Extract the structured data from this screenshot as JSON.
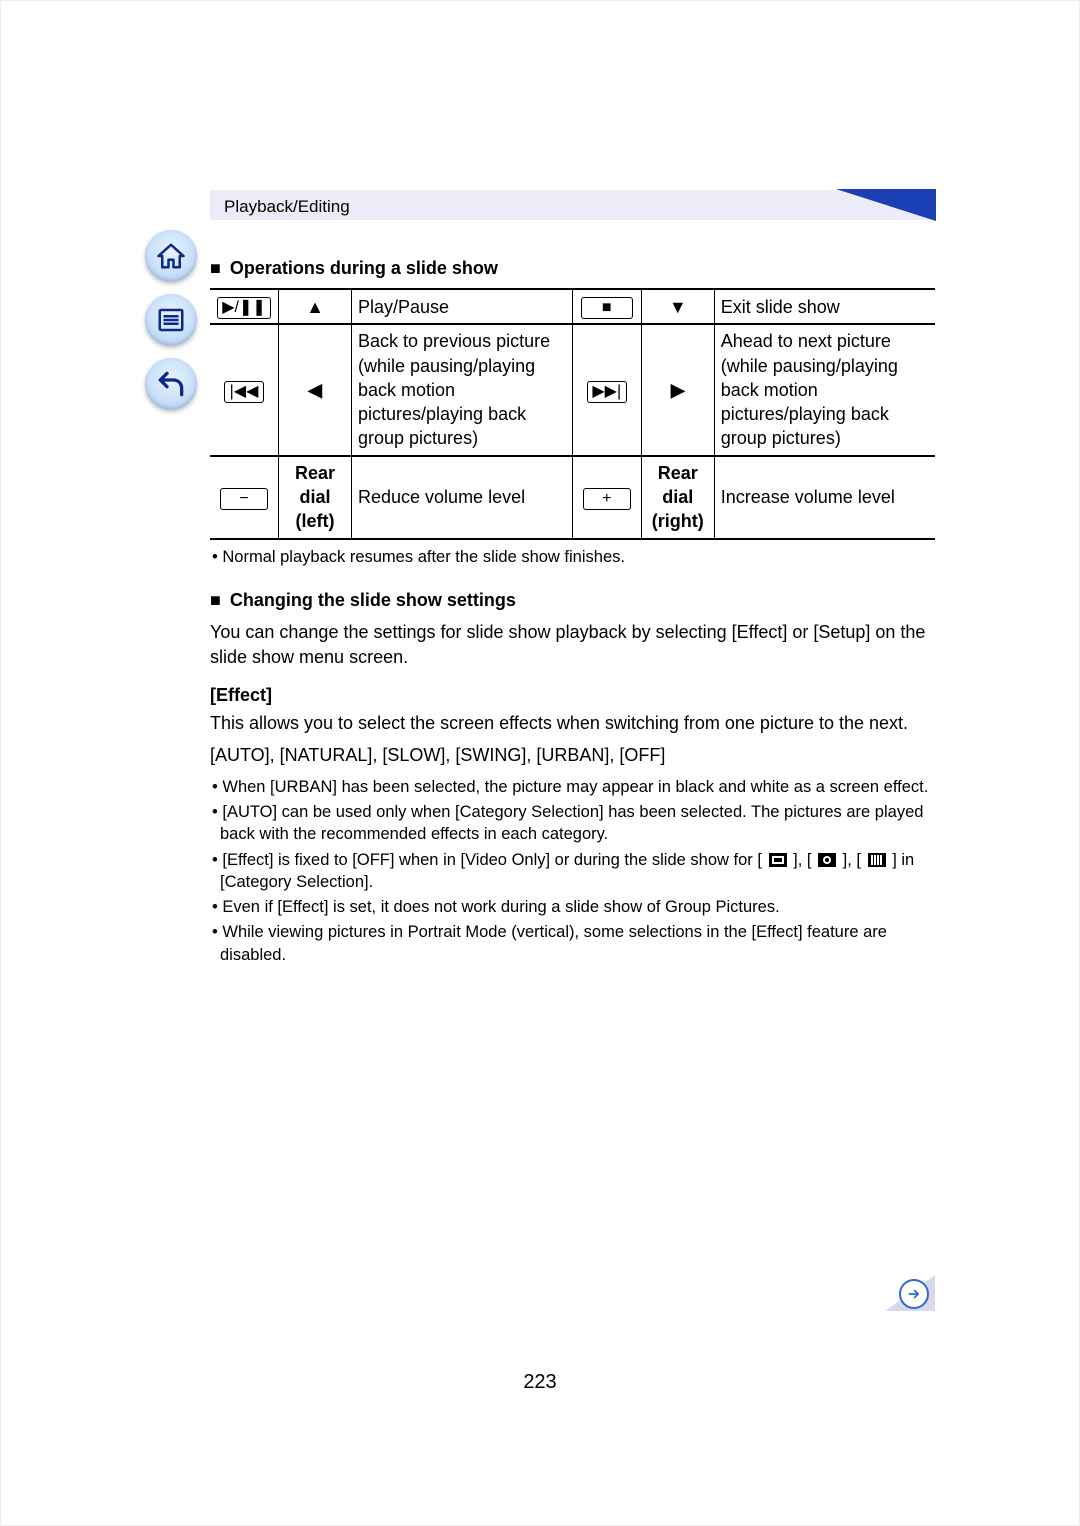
{
  "header": {
    "breadcrumb": "Playback/Editing"
  },
  "page_number": "223",
  "sections": {
    "ops_title": "Operations during a slide show",
    "settings_title": "Changing the slide show settings",
    "settings_intro": "You can change the settings for slide show playback by selecting [Effect] or [Setup] on the slide show menu screen.",
    "effect_label": "[Effect]",
    "effect_intro": "This allows you to select the screen effects when switching from one picture to the next.",
    "effect_options": "[AUTO], [NATURAL], [SLOW], [SWING], [URBAN], [OFF]"
  },
  "ops_table": {
    "rows": [
      {
        "iconL": "▶/❚❚",
        "keyL": "▲",
        "descL": "Play/Pause",
        "iconR": "■",
        "keyR": "▼",
        "descR": "Exit slide show"
      },
      {
        "iconL": "|◀◀",
        "keyL": "◀",
        "descL": "Back to previous picture (while pausing/playing back motion pictures/playing back group pictures)",
        "iconR": "▶▶|",
        "keyR": "▶",
        "descR": "Ahead to next picture (while pausing/playing back motion pictures/playing back group pictures)"
      },
      {
        "iconL": "−",
        "keyL_label": "Rear dial (left)",
        "descL": "Reduce volume level",
        "iconR": "+",
        "keyR_label": "Rear dial (right)",
        "descR": "Increase volume level"
      }
    ],
    "footnote": "Normal playback resumes after the slide show finishes."
  },
  "effect_bullets": [
    "When [URBAN] has been selected, the picture may appear in black and white as a screen effect.",
    "[AUTO] can be used only when [Category Selection] has been selected. The pictures are played back with the recommended effects in each category.",
    "[Effect] is fixed to [OFF] when in [Video Only] or during the slide show for [ ☐ ], [ ☐ ], [ ☐ ] in [Category Selection].",
    "Even if [Effect] is set, it does not work during a slide show of Group Pictures.",
    "While viewing pictures in Portrait Mode (vertical), some selections in the [Effect] feature are disabled."
  ],
  "nav_icons": [
    "home-icon",
    "toc-icon",
    "back-icon"
  ]
}
